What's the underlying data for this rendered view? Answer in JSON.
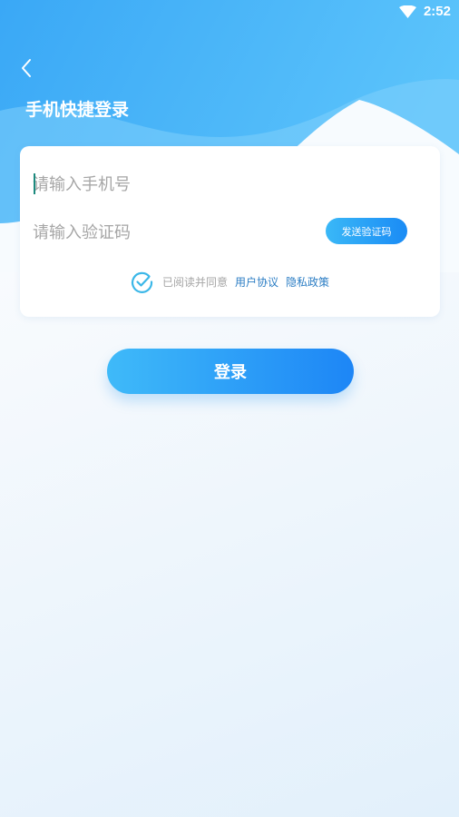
{
  "status_bar": {
    "time": "2:52"
  },
  "header": {
    "title": "手机快捷登录"
  },
  "form": {
    "phone_placeholder": "请输入手机号",
    "code_placeholder": "请输入验证码",
    "send_code_label": "发送验证码",
    "agreement_prefix": "已阅读并同意",
    "user_agreement_link": "用户协议",
    "privacy_policy_link": "隐私政策"
  },
  "login_button_label": "登录",
  "colors": {
    "primary": "#1d86f6",
    "primary_light": "#3fbaf9",
    "link": "#2b7dc4",
    "check": "#3bb7e8"
  }
}
